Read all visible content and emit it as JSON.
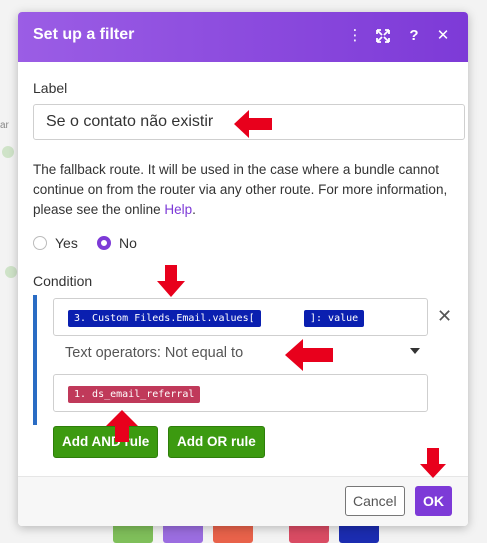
{
  "background": {
    "side_text": "ar"
  },
  "dialog": {
    "title": "Set up a filter",
    "header_icons": [
      "more-vertical-icon",
      "expand-icon",
      "help-icon",
      "close-icon"
    ],
    "header_icon_glyphs": {
      "more": "⋮",
      "expand": "⤧",
      "help": "?",
      "close": "✕"
    }
  },
  "label_field": {
    "heading": "Label",
    "value": "Se o contato não existir"
  },
  "fallback": {
    "text": "The fallback route. It will be used in the case where a bundle cannot continue on from the router via any other route. For more information, please see the online ",
    "link": "Help",
    "end": "."
  },
  "radios": [
    {
      "label": "Yes",
      "checked": false
    },
    {
      "label": "No",
      "checked": true
    }
  ],
  "condition": {
    "heading": "Condition",
    "first_operand": {
      "pill_a": "3. Custom Fileds.Email.values[",
      "pill_b": "]: value"
    },
    "operator": "Text operators: Not equal to",
    "second_operand": {
      "pill": "1. ds_email_referral"
    },
    "remove_glyph": "✕"
  },
  "buttons": {
    "add_and": "Add AND rule",
    "add_or": "Add OR rule",
    "cancel": "Cancel",
    "ok": "OK"
  },
  "colors": {
    "accent": "#7d3ad7",
    "header_gradient_start": "#9b5de5",
    "pill_blue": "#0a1fb0",
    "pill_red": "#c0395a",
    "green_button": "#3c9a10",
    "annotation_arrow": "#e8001c",
    "condition_bar": "#2a6cc4"
  }
}
